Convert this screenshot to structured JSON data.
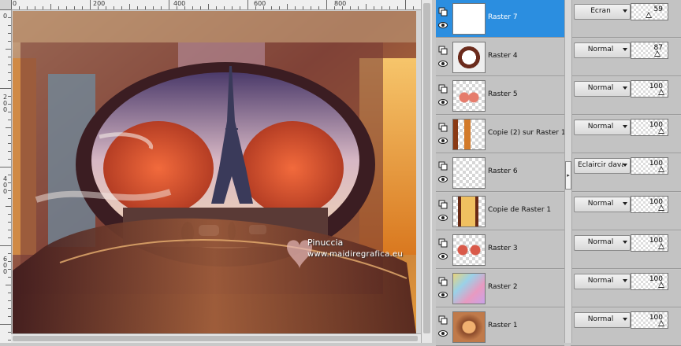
{
  "rulers": {
    "top_labels": [
      "0",
      "200",
      "400",
      "600",
      "800"
    ],
    "left_labels": [
      "0",
      "2\n0\n0",
      "4\n0\n0",
      "6\n0\n0"
    ]
  },
  "watermark": {
    "name": "Pinuccia",
    "url": "www.maidiregrafica.eu"
  },
  "layers": [
    {
      "name": "Raster 7",
      "selected": true,
      "blend_mode": "Écran",
      "opacity": 59
    },
    {
      "name": "Raster 4",
      "selected": false,
      "blend_mode": "Normal",
      "opacity": 87
    },
    {
      "name": "Raster 5",
      "selected": false,
      "blend_mode": "Normal",
      "opacity": 100
    },
    {
      "name": "Copie (2) sur Raster 1",
      "selected": false,
      "blend_mode": "Normal",
      "opacity": 100
    },
    {
      "name": "Raster 6",
      "selected": false,
      "blend_mode": "Éclaircir davantage",
      "opacity": 100
    },
    {
      "name": "Copie de Raster 1",
      "selected": false,
      "blend_mode": "Normal",
      "opacity": 100
    },
    {
      "name": "Raster 3",
      "selected": false,
      "blend_mode": "Normal",
      "opacity": 100
    },
    {
      "name": "Raster 2",
      "selected": false,
      "blend_mode": "Normal",
      "opacity": 100
    },
    {
      "name": "Raster 1",
      "selected": false,
      "blend_mode": "Normal",
      "opacity": 100
    }
  ],
  "icons": {
    "layer_group": "layer-group-icon",
    "visibility": "eye-icon"
  },
  "colors": {
    "selected_row": "#2b8ee0",
    "panel_bg": "#c8c8c8"
  }
}
